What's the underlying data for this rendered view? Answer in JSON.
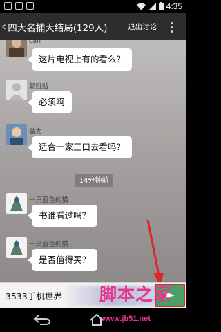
{
  "status_bar": {
    "time": "4:35"
  },
  "header": {
    "title": "四大名捕大结局(129人)",
    "exit_label": "退出讨论"
  },
  "messages": [
    {
      "sender": "can",
      "text": "这片电视上有的看么？"
    },
    {
      "sender": "郭贼贼",
      "text": "必须啊"
    },
    {
      "sender": "善为",
      "text": "适合一家三口去看吗？"
    },
    {
      "sender": "一只蓝色的猫",
      "text": "书谁看过吗？"
    },
    {
      "sender": "一只蓝色的猫",
      "text": "是否值得买？"
    }
  ],
  "time_divider": "14分钟前",
  "input": {
    "value": "3533手机世界"
  },
  "watermark": {
    "title": "脚本之家",
    "url": "www.jb51.net"
  },
  "colors": {
    "send_button": "#4aa067",
    "highlight": "#e0242c",
    "watermark": "#e8348d"
  },
  "icons": [
    "back-chevron-icon",
    "overflow-menu-icon",
    "wifi-icon",
    "signal-icon",
    "battery-icon",
    "nav-back-icon",
    "nav-home-icon"
  ]
}
